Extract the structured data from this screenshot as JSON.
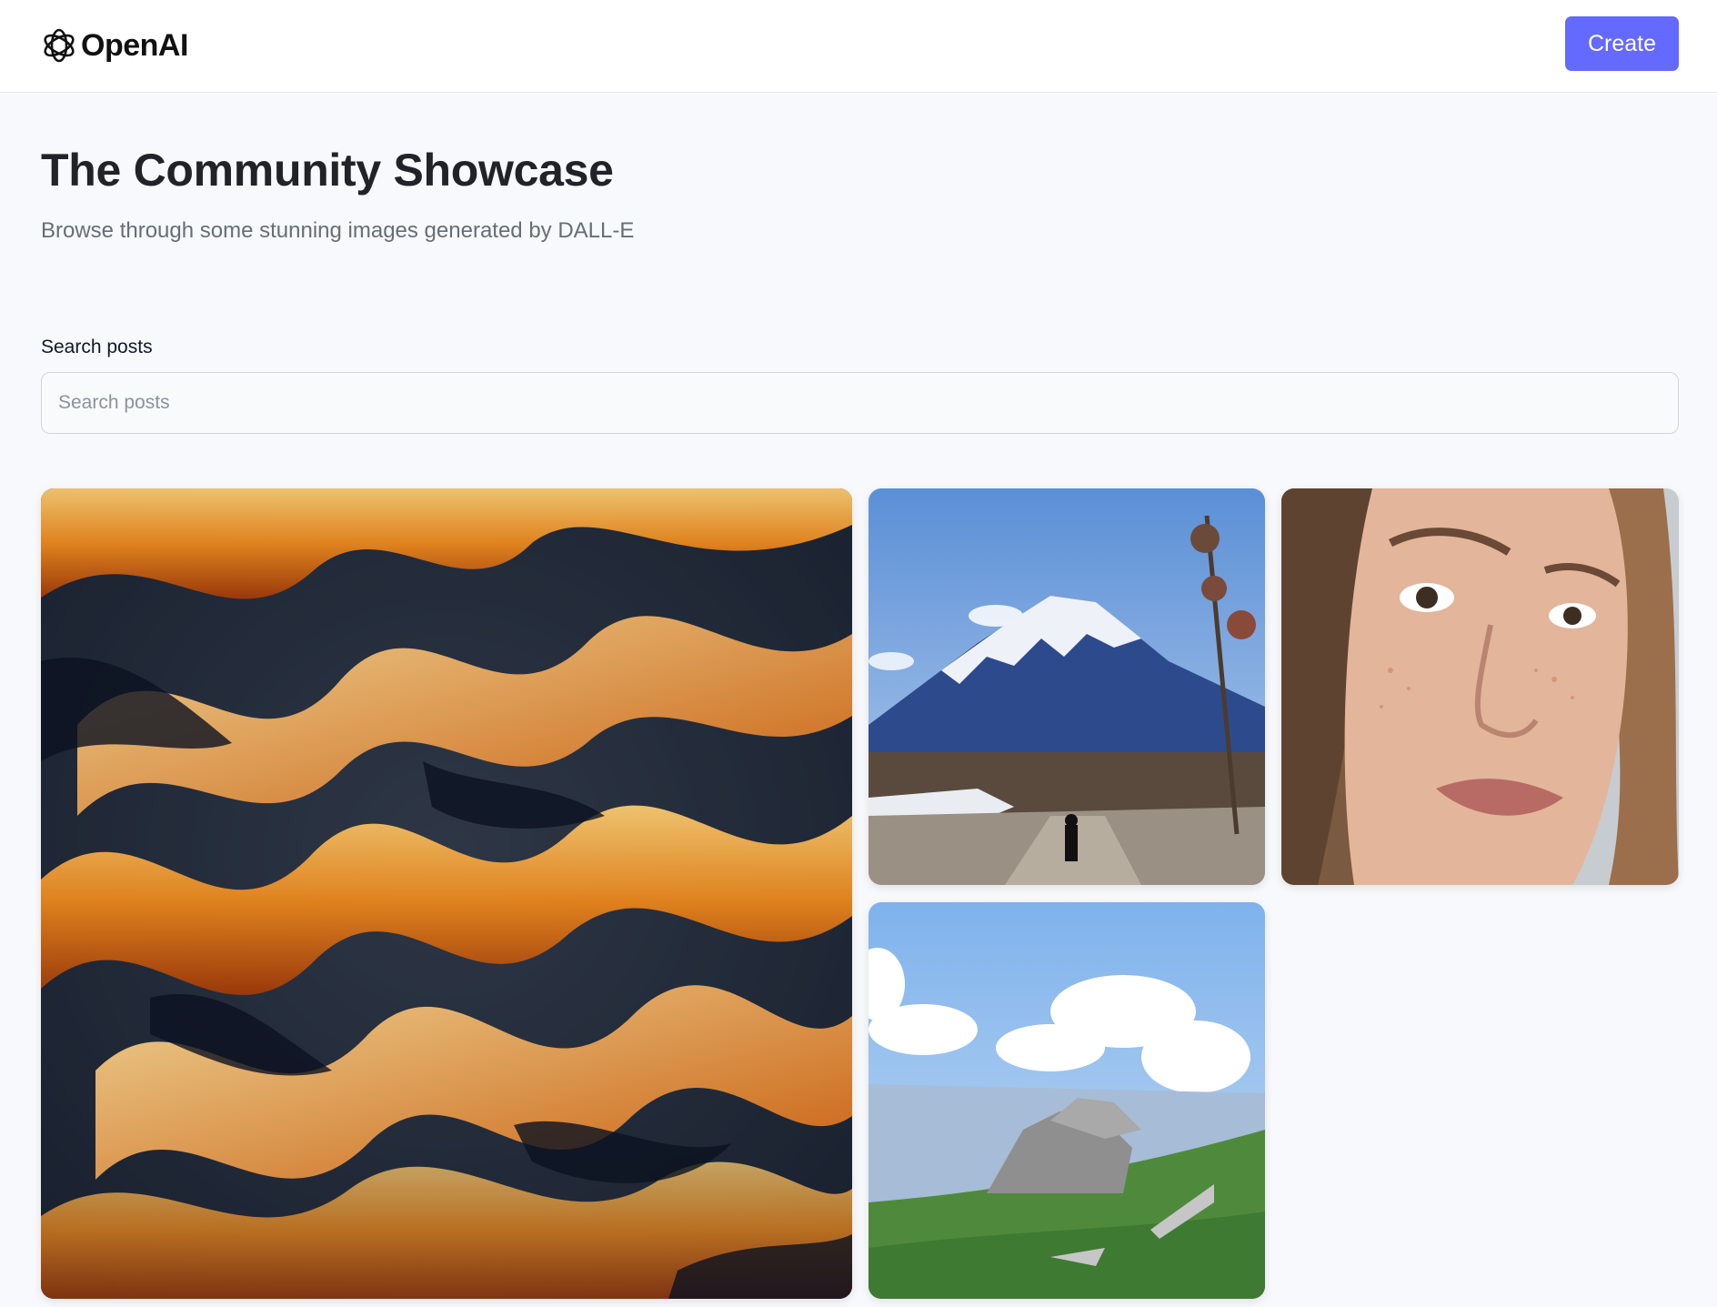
{
  "header": {
    "brand": "OpenAI",
    "logo_icon": "openai-logo-icon",
    "create_label": "Create",
    "accent_color": "#6469ff"
  },
  "main": {
    "title": "The Community Showcase",
    "subtitle": "Browse through some stunning images generated by DALL-E",
    "search": {
      "label": "Search posts",
      "placeholder": "Search posts",
      "value": ""
    }
  },
  "gallery": {
    "items": [
      {
        "subject": "fire"
      },
      {
        "subject": "snowy mountain"
      },
      {
        "subject": "freckled face"
      },
      {
        "subject": "rocky hill"
      }
    ]
  }
}
